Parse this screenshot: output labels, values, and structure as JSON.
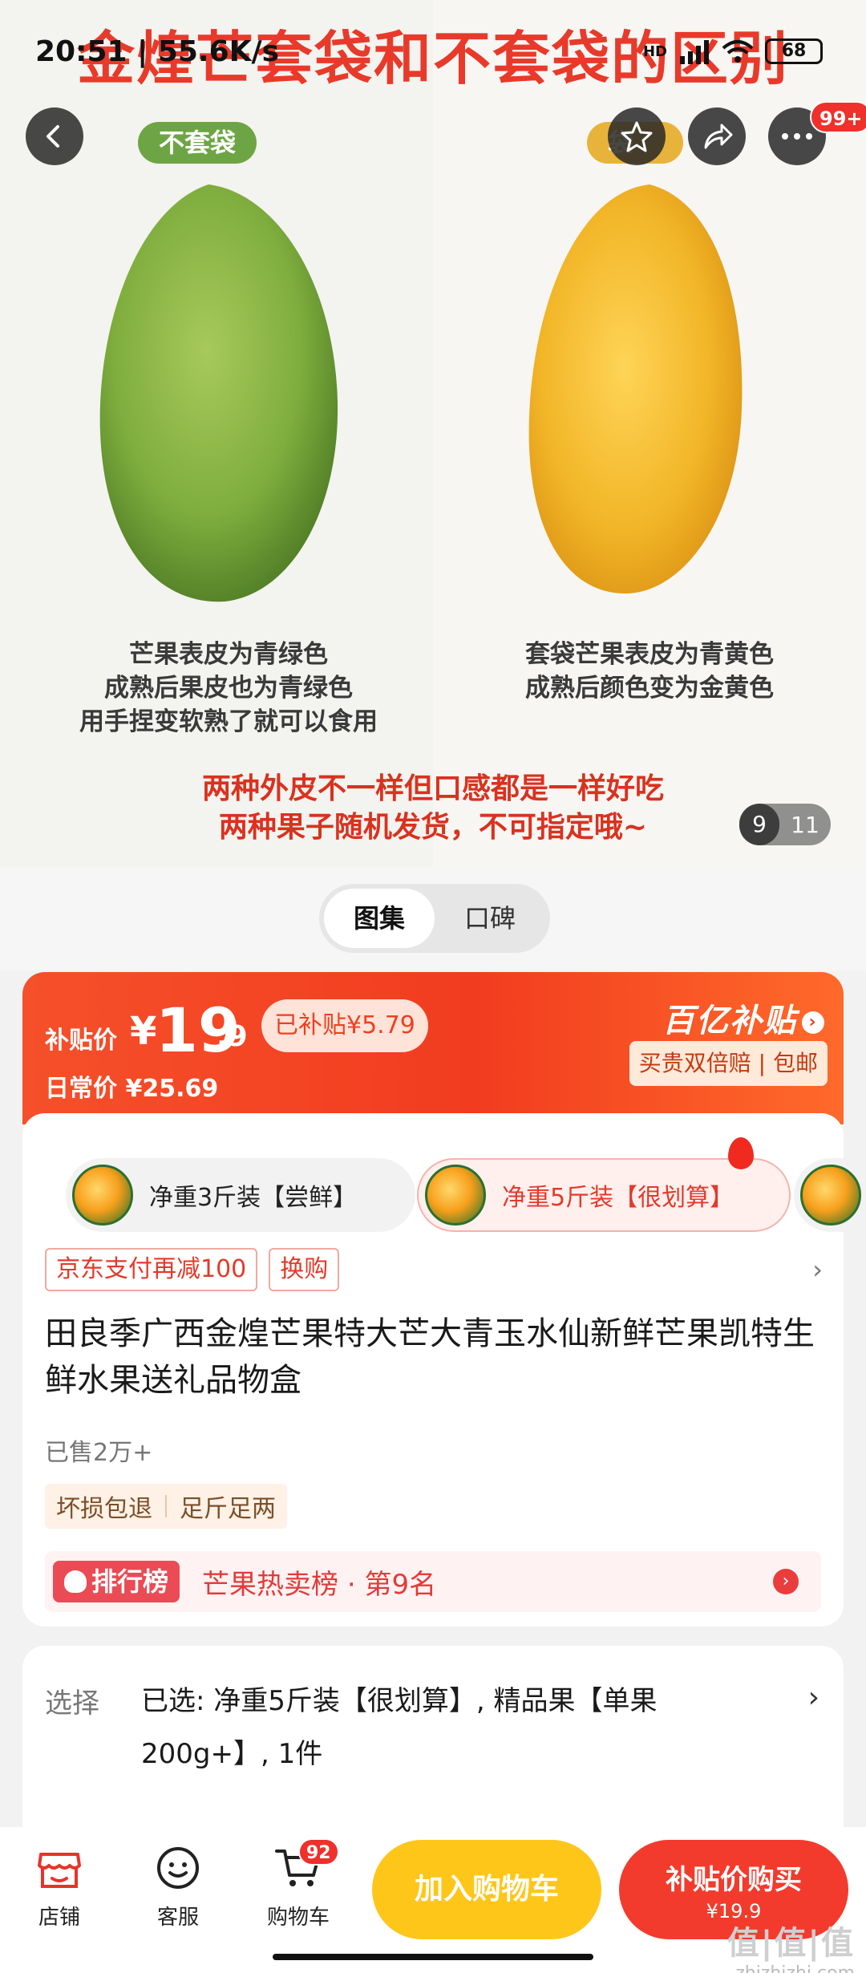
{
  "status_bar": {
    "time": "20:51",
    "speed": "55.6K/s",
    "network": "HD",
    "battery": "68"
  },
  "hero": {
    "title": "金煌芒套袋和不套袋的区别",
    "left_tag": "不套袋",
    "right_tag": "袋",
    "left_caption": [
      "芒果表皮为青绿色",
      "成熟后果皮也为青绿色",
      "用手捏变软熟了就可以食用"
    ],
    "right_caption": [
      "套袋芒果表皮为青黄色",
      "成熟后颜色变为金黄色"
    ],
    "bottom_caption": [
      "两种外皮不一样但口感都是一样好吃",
      "两种果子随机发货，不可指定哦~"
    ],
    "page_current": "9",
    "page_total": "11",
    "more_badge": "99+"
  },
  "gallery_tabs": [
    "图集",
    "口碑"
  ],
  "price": {
    "label": "补贴价",
    "yen": "¥",
    "integer": "19",
    "decimal": ".9",
    "subsidy_badge": "已补贴¥5.79",
    "daily_label": "日常价 ¥25.69",
    "brand": "百亿补贴",
    "guarantee": "买贵双倍赔 | 包邮"
  },
  "specs": [
    {
      "label": "净重3斤装【尝鲜】"
    },
    {
      "label": "净重5斤装【很划算】"
    }
  ],
  "promos": [
    "京东支付再减100",
    "换购"
  ],
  "product": {
    "title": "田良季广西金煌芒果特大芒大青玉水仙新鲜芒果凯特生鲜水果送礼品物盒",
    "sold": "已售2万+",
    "service_tags": [
      "坏损包退",
      "足斤足两"
    ],
    "rank_badge": "排行榜",
    "rank_text": "芒果热卖榜 · 第9名"
  },
  "selection": {
    "label": "选择",
    "value": "已选: 净重5斤装【很划算】, 精品果【单果200g+】, 1件"
  },
  "bottom_bar": {
    "store": "店铺",
    "service": "客服",
    "cart": "购物车",
    "cart_count": "92",
    "add_to_cart": "加入购物车",
    "buy_label": "补贴价购买",
    "buy_price": "¥19.9"
  },
  "watermark": {
    "logo": "值|值|值",
    "site": "zhizhizhi.com"
  },
  "colors": {
    "accent": "#f23b2c",
    "cart_button": "#ffc61a",
    "green_mango": "#7fae3e",
    "yellow_mango": "#f2b628"
  }
}
